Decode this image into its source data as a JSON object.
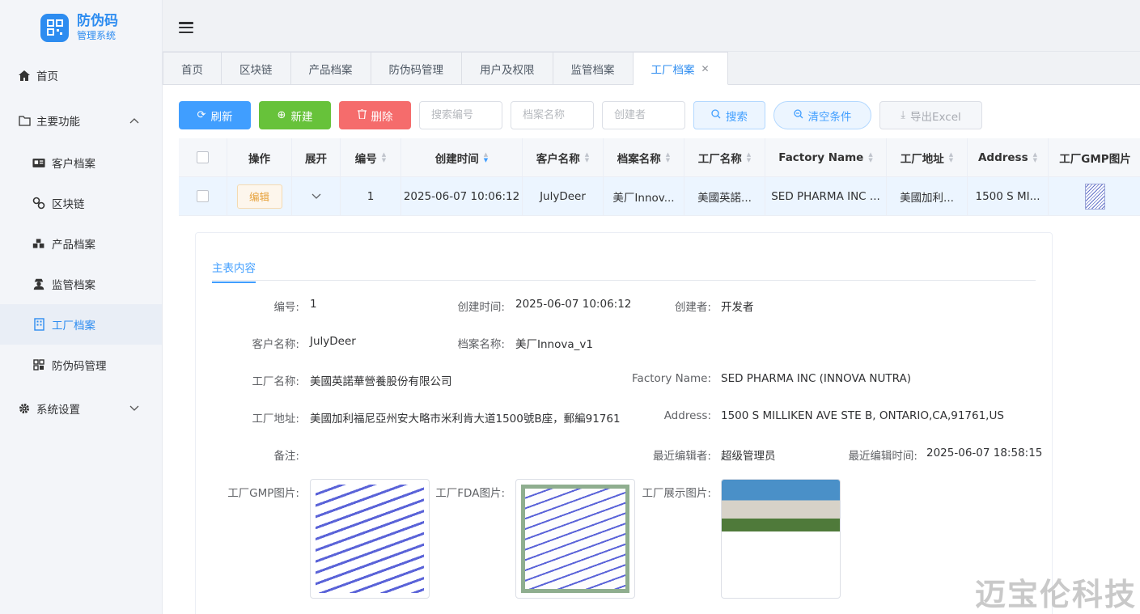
{
  "app": {
    "title": "防伪码",
    "subtitle": "管理系统"
  },
  "sidebar": {
    "home": "首页",
    "main_functions": "主要功能",
    "items": [
      "客户档案",
      "区块链",
      "产品档案",
      "监管档案",
      "工厂档案",
      "防伪码管理"
    ],
    "settings": "系统设置"
  },
  "tabs": [
    "首页",
    "区块链",
    "产品档案",
    "防伪码管理",
    "用户及权限",
    "监管档案",
    "工厂档案"
  ],
  "toolbar": {
    "refresh": "刷新",
    "create": "新建",
    "delete": "删除",
    "search_no_placeholder": "搜索编号",
    "archive_name_placeholder": "档案名称",
    "creator_placeholder": "创建者",
    "search": "搜索",
    "clear": "清空条件",
    "export": "导出Excel"
  },
  "table": {
    "headers": [
      "操作",
      "展开",
      "编号",
      "创建时间",
      "客户名称",
      "档案名称",
      "工厂名称",
      "Factory Name",
      "工厂地址",
      "Address",
      "工厂GMP图片"
    ],
    "row": {
      "edit": "编辑",
      "id": "1",
      "created": "2025-06-07 10:06:12",
      "customer": "JulyDeer",
      "archive": "美厂Innov...",
      "factory": "美國英諾...",
      "factory_en": "SED PHARMA INC ...",
      "addr": "美國加利...",
      "address": "1500 S MI..."
    }
  },
  "detail": {
    "tab": "主表内容",
    "labels": {
      "id": "编号:",
      "created": "创建时间:",
      "creator": "创建者:",
      "customer": "客户名称:",
      "archive": "档案名称:",
      "factory": "工厂名称:",
      "factory_en": "Factory Name:",
      "addr": "工厂地址:",
      "address": "Address:",
      "note": "备注:",
      "editor": "最近编辑者:",
      "edit_time": "最近编辑时间:",
      "gmp": "工厂GMP图片:",
      "fda": "工厂FDA图片:",
      "show": "工厂展示图片:"
    },
    "values": {
      "id": "1",
      "created": "2025-06-07 10:06:12",
      "creator": "开发者",
      "customer": "JulyDeer",
      "archive": "美厂Innova_v1",
      "factory": "美國英諾華營養股份有限公司",
      "factory_en": "SED PHARMA INC (INNOVA NUTRA)",
      "addr": "美國加利福尼亞州安大略市米利肯大道1500號B座，郵編91761",
      "address": "1500 S MILLIKEN AVE STE B, ONTARIO,CA,91761,US",
      "editor": "超级管理员",
      "edit_time": "2025-06-07 18:58:15"
    }
  },
  "watermark": "迈宝伦科技"
}
